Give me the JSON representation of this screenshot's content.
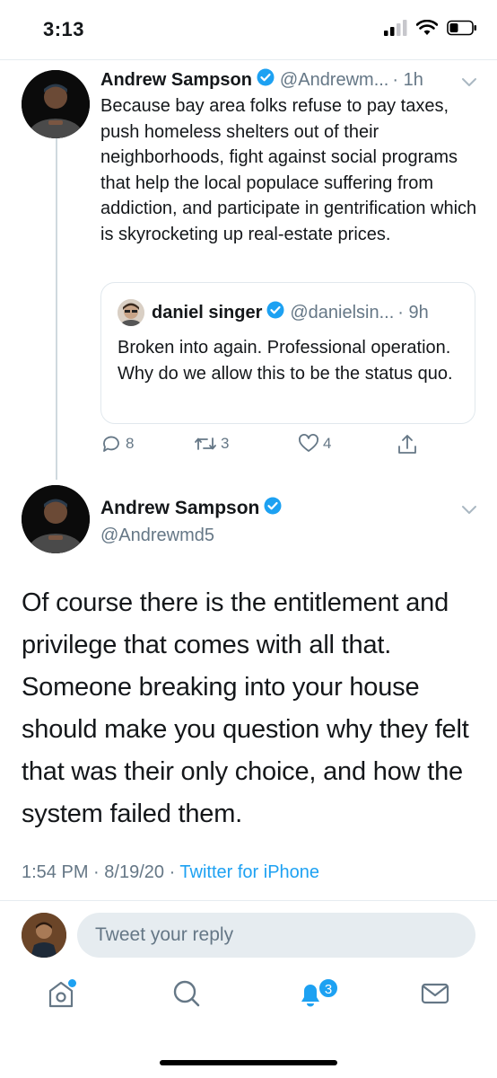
{
  "status_bar": {
    "time": "3:13"
  },
  "thread_tweet": {
    "author_name": "Andrew Sampson",
    "handle_truncated": "@Andrewm...",
    "age": "· 1h",
    "text": "Because bay area folks refuse to pay taxes, push homeless shelters out of their neighborhoods, fight against social programs that help the local populace suffering from addiction, and participate in gentrification which is skyrocketing up real-estate prices."
  },
  "quoted_tweet": {
    "author_name": "daniel singer",
    "handle_truncated": "@danielsin...",
    "age": "· 9h",
    "text": "Broken into again. Professional operation. Why do we allow this to be the status quo."
  },
  "actions": {
    "reply_count": "8",
    "retweet_count": "3",
    "like_count": "4"
  },
  "main_tweet": {
    "author_name": "Andrew Sampson",
    "handle": "@Andrewmd5",
    "text": "Of course there is the entitlement and privilege that comes with all that. Someone breaking into your house should make you question why they felt that was their only choice, and how the system failed them.",
    "time": "1:54 PM",
    "date": "8/19/20",
    "source": "Twitter for iPhone"
  },
  "reply": {
    "placeholder": "Tweet your reply"
  },
  "tabs": {
    "notifications_badge": "3",
    "icons": [
      "home-icon",
      "search-icon",
      "bell-icon",
      "mail-icon"
    ]
  },
  "colors": {
    "accent": "#1da1f2",
    "secondary_text": "#657786",
    "primary_text": "#14171a",
    "border": "#e1e8ed"
  }
}
